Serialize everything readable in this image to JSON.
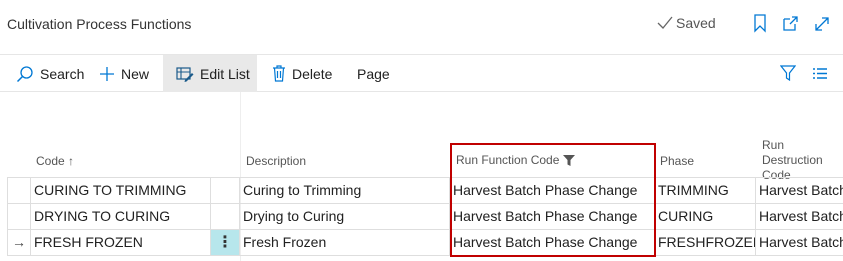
{
  "page": {
    "title": "Cultivation Process Functions",
    "saved_label": "Saved"
  },
  "titlebar_icons": [
    "bookmark-icon",
    "open-in-new-window-icon",
    "expand-icon"
  ],
  "actions": {
    "search": "Search",
    "new": "New",
    "edit_list": "Edit List",
    "delete": "Delete",
    "page": "Page"
  },
  "columns": {
    "code": "Code",
    "code_sort": "↑",
    "description": "Description",
    "run_function_code": "Run Function Code",
    "phase": "Phase",
    "run_destruction_code": "Run Destruction Code"
  },
  "rows": [
    {
      "indicator": "",
      "code": "CURING TO TRIMMING",
      "description": "Curing to Trimming",
      "run_function_code": "Harvest Batch Phase Change",
      "phase": "TRIMMING",
      "run_destruction_code": "Harvest Batch"
    },
    {
      "indicator": "",
      "code": "DRYING TO CURING",
      "description": "Drying to Curing",
      "run_function_code": "Harvest Batch Phase Change",
      "phase": "CURING",
      "run_destruction_code": "Harvest Batch"
    },
    {
      "indicator": "→",
      "code": "FRESH FROZEN",
      "description": "Fresh Frozen",
      "run_function_code": "Harvest Batch Phase Change",
      "phase": "FRESHFROZEN",
      "run_destruction_code": "Harvest Batch",
      "menu": "⋮"
    }
  ],
  "colors": {
    "accent": "#0078d4",
    "highlight_border": "#c00000",
    "selected_cell": "#b7e6ec"
  }
}
